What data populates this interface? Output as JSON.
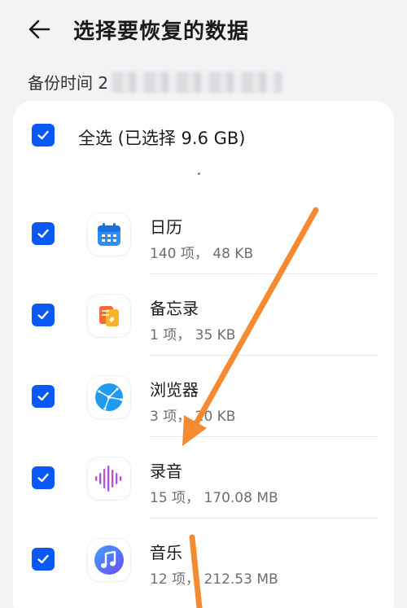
{
  "header": {
    "back_icon": "arrow-left-icon",
    "title": "选择要恢复的数据"
  },
  "backup": {
    "label": "备份时间 2"
  },
  "select_all": {
    "label": "全选 (已选择 9.6 GB)",
    "checked": true
  },
  "items": [
    {
      "name": "日历",
      "meta": "140 项， 48 KB",
      "icon": "calendar-icon",
      "checked": true
    },
    {
      "name": "备忘录",
      "meta": "1 项， 35 KB",
      "icon": "notepad-icon",
      "checked": true
    },
    {
      "name": "浏览器",
      "meta": "3 项， 20 KB",
      "icon": "browser-globe-icon",
      "checked": true
    },
    {
      "name": "录音",
      "meta": "15 项， 170.08 MB",
      "icon": "recorder-waveform-icon",
      "checked": true
    },
    {
      "name": "音乐",
      "meta": "12 项， 212.53 MB",
      "icon": "music-note-icon",
      "checked": true
    }
  ],
  "colors": {
    "accent": "#0a59f7",
    "annotation_arrow": "#f58a33",
    "background": "#f1f3f5"
  }
}
